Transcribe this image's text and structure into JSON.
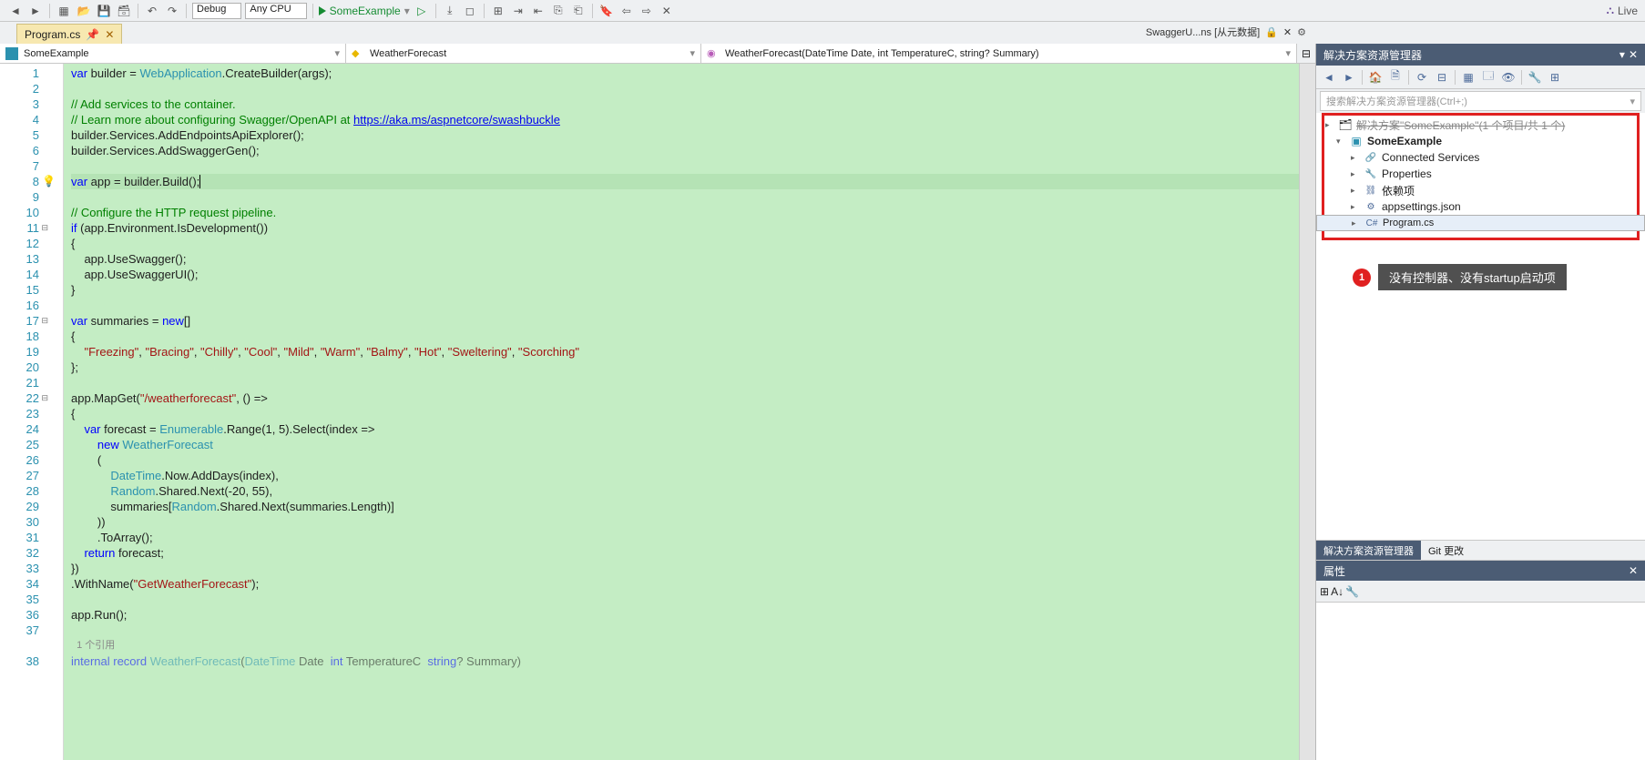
{
  "toolbar": {
    "configs": [
      "Debug",
      "Any CPU"
    ],
    "run_target": "SomeExample",
    "live_share": "Live"
  },
  "doc_tab": {
    "name": "Program.cs"
  },
  "title_extra": "SwaggerU...ns [从元数据]",
  "combos": {
    "project": "SomeExample",
    "class": "WeatherForecast",
    "member": "WeatherForecast(DateTime Date, int TemperatureC, string? Summary)"
  },
  "code": {
    "lines": [
      {
        "n": 1,
        "seg": [
          [
            "kw",
            "var"
          ],
          [
            "",
            " builder = "
          ],
          [
            "typ",
            "WebApplication"
          ],
          [
            "",
            ".CreateBuilder(args);"
          ]
        ]
      },
      {
        "n": 2,
        "seg": [
          [
            "",
            ""
          ]
        ]
      },
      {
        "n": 3,
        "seg": [
          [
            "cmt",
            "// Add services to the container."
          ]
        ]
      },
      {
        "n": 4,
        "seg": [
          [
            "cmt",
            "// Learn more about configuring Swagger/OpenAPI at "
          ],
          [
            "lnk",
            "https://aka.ms/aspnetcore/swashbuckle"
          ]
        ]
      },
      {
        "n": 5,
        "seg": [
          [
            "",
            "builder.Services.AddEndpointsApiExplorer();"
          ]
        ]
      },
      {
        "n": 6,
        "seg": [
          [
            "",
            "builder.Services.AddSwaggerGen();"
          ]
        ]
      },
      {
        "n": 7,
        "seg": [
          [
            "",
            ""
          ]
        ]
      },
      {
        "n": 8,
        "cur": true,
        "bulb": true,
        "seg": [
          [
            "kw",
            "var"
          ],
          [
            "",
            " app = builder.Build();"
          ]
        ]
      },
      {
        "n": 9,
        "seg": [
          [
            "",
            ""
          ]
        ]
      },
      {
        "n": 10,
        "seg": [
          [
            "cmt",
            "// Configure the HTTP request pipeline."
          ]
        ]
      },
      {
        "n": 11,
        "fold": true,
        "seg": [
          [
            "kw",
            "if"
          ],
          [
            "",
            " (app.Environment.IsDevelopment())"
          ]
        ]
      },
      {
        "n": 12,
        "seg": [
          [
            "",
            "{"
          ]
        ]
      },
      {
        "n": 13,
        "seg": [
          [
            "",
            "    app.UseSwagger();"
          ]
        ]
      },
      {
        "n": 14,
        "seg": [
          [
            "",
            "    app.UseSwaggerUI();"
          ]
        ]
      },
      {
        "n": 15,
        "seg": [
          [
            "",
            "}"
          ]
        ]
      },
      {
        "n": 16,
        "seg": [
          [
            "",
            ""
          ]
        ]
      },
      {
        "n": 17,
        "fold": true,
        "seg": [
          [
            "kw",
            "var"
          ],
          [
            "",
            " summaries = "
          ],
          [
            "kw",
            "new"
          ],
          [
            "",
            "[]"
          ]
        ]
      },
      {
        "n": 18,
        "seg": [
          [
            "",
            "{"
          ]
        ]
      },
      {
        "n": 19,
        "seg": [
          [
            "",
            "    "
          ],
          [
            "str",
            "\"Freezing\""
          ],
          [
            "",
            ", "
          ],
          [
            "str",
            "\"Bracing\""
          ],
          [
            "",
            ", "
          ],
          [
            "str",
            "\"Chilly\""
          ],
          [
            "",
            ", "
          ],
          [
            "str",
            "\"Cool\""
          ],
          [
            "",
            ", "
          ],
          [
            "str",
            "\"Mild\""
          ],
          [
            "",
            ", "
          ],
          [
            "str",
            "\"Warm\""
          ],
          [
            "",
            ", "
          ],
          [
            "str",
            "\"Balmy\""
          ],
          [
            "",
            ", "
          ],
          [
            "str",
            "\"Hot\""
          ],
          [
            "",
            ", "
          ],
          [
            "str",
            "\"Sweltering\""
          ],
          [
            "",
            ", "
          ],
          [
            "str",
            "\"Scorching\""
          ]
        ]
      },
      {
        "n": 20,
        "seg": [
          [
            "",
            "};"
          ]
        ]
      },
      {
        "n": 21,
        "seg": [
          [
            "",
            ""
          ]
        ]
      },
      {
        "n": 22,
        "fold": true,
        "seg": [
          [
            "",
            "app.MapGet("
          ],
          [
            "str",
            "\"/weatherforecast\""
          ],
          [
            "",
            ", () =>"
          ]
        ]
      },
      {
        "n": 23,
        "seg": [
          [
            "",
            "{"
          ]
        ]
      },
      {
        "n": 24,
        "seg": [
          [
            "",
            "    "
          ],
          [
            "kw",
            "var"
          ],
          [
            "",
            " forecast = "
          ],
          [
            "typ",
            "Enumerable"
          ],
          [
            "",
            ".Range(1, 5).Select(index =>"
          ]
        ]
      },
      {
        "n": 25,
        "seg": [
          [
            "",
            "        "
          ],
          [
            "kw",
            "new"
          ],
          [
            "",
            " "
          ],
          [
            "typ",
            "WeatherForecast"
          ]
        ]
      },
      {
        "n": 26,
        "seg": [
          [
            "",
            "        ("
          ]
        ]
      },
      {
        "n": 27,
        "seg": [
          [
            "",
            "            "
          ],
          [
            "typ",
            "DateTime"
          ],
          [
            "",
            ".Now.AddDays(index),"
          ]
        ]
      },
      {
        "n": 28,
        "seg": [
          [
            "",
            "            "
          ],
          [
            "typ",
            "Random"
          ],
          [
            "",
            ".Shared.Next(-20, 55),"
          ]
        ]
      },
      {
        "n": 29,
        "seg": [
          [
            "",
            "            summaries["
          ],
          [
            "typ",
            "Random"
          ],
          [
            "",
            ".Shared.Next(summaries.Length)]"
          ]
        ]
      },
      {
        "n": 30,
        "seg": [
          [
            "",
            "        ))"
          ]
        ]
      },
      {
        "n": 31,
        "seg": [
          [
            "",
            "        .ToArray();"
          ]
        ]
      },
      {
        "n": 32,
        "seg": [
          [
            "",
            "    "
          ],
          [
            "kw",
            "return"
          ],
          [
            "",
            " forecast;"
          ]
        ]
      },
      {
        "n": 33,
        "seg": [
          [
            "",
            "})"
          ]
        ]
      },
      {
        "n": 34,
        "seg": [
          [
            "",
            ".WithName("
          ],
          [
            "str",
            "\"GetWeatherForecast\""
          ],
          [
            "",
            ");"
          ]
        ]
      },
      {
        "n": 35,
        "seg": [
          [
            "",
            ""
          ]
        ]
      },
      {
        "n": 36,
        "seg": [
          [
            "",
            "app.Run();"
          ]
        ]
      },
      {
        "n": 37,
        "seg": [
          [
            "",
            ""
          ]
        ]
      }
    ],
    "codelens": "1 个引用",
    "trailing_line_num": 38,
    "trailing": [
      [
        "kw",
        "internal record "
      ],
      [
        "typ",
        "WeatherForecast"
      ],
      [
        "",
        "("
      ],
      [
        "typ",
        "DateTime"
      ],
      [
        "",
        " Date  "
      ],
      [
        "kw",
        "int"
      ],
      [
        "",
        " TemperatureC  "
      ],
      [
        "kw",
        "string"
      ],
      [
        "",
        "? Summary)"
      ]
    ]
  },
  "solutionExplorer": {
    "title": "解决方案资源管理器",
    "search_placeholder": "搜索解决方案资源管理器(Ctrl+;)",
    "solution": "解决方案\"SomeExample\"(1 个项目/共 1 个)",
    "project": "SomeExample",
    "nodes": [
      "Connected Services",
      "Properties",
      "依赖项",
      "appsettings.json",
      "Program.cs"
    ],
    "callout_num": "1",
    "callout_text": "没有控制器、没有startup启动项",
    "tabs": [
      "解决方案资源管理器",
      "Git 更改"
    ]
  },
  "properties": {
    "title": "属性"
  }
}
